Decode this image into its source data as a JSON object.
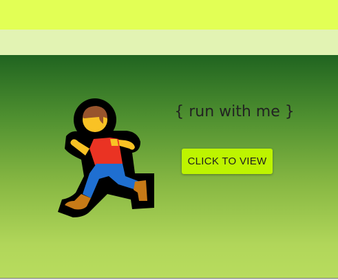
{
  "hero": {
    "icon": "person-running-icon",
    "tagline": "{ run with me }",
    "button_label": "CLICK TO VIEW"
  },
  "colors": {
    "top_bar": "#e2ff55",
    "sub_bar": "#e2f3b3",
    "hero_top": "#206420",
    "hero_bottom": "#b8dc5e",
    "button": "#bdf400"
  }
}
